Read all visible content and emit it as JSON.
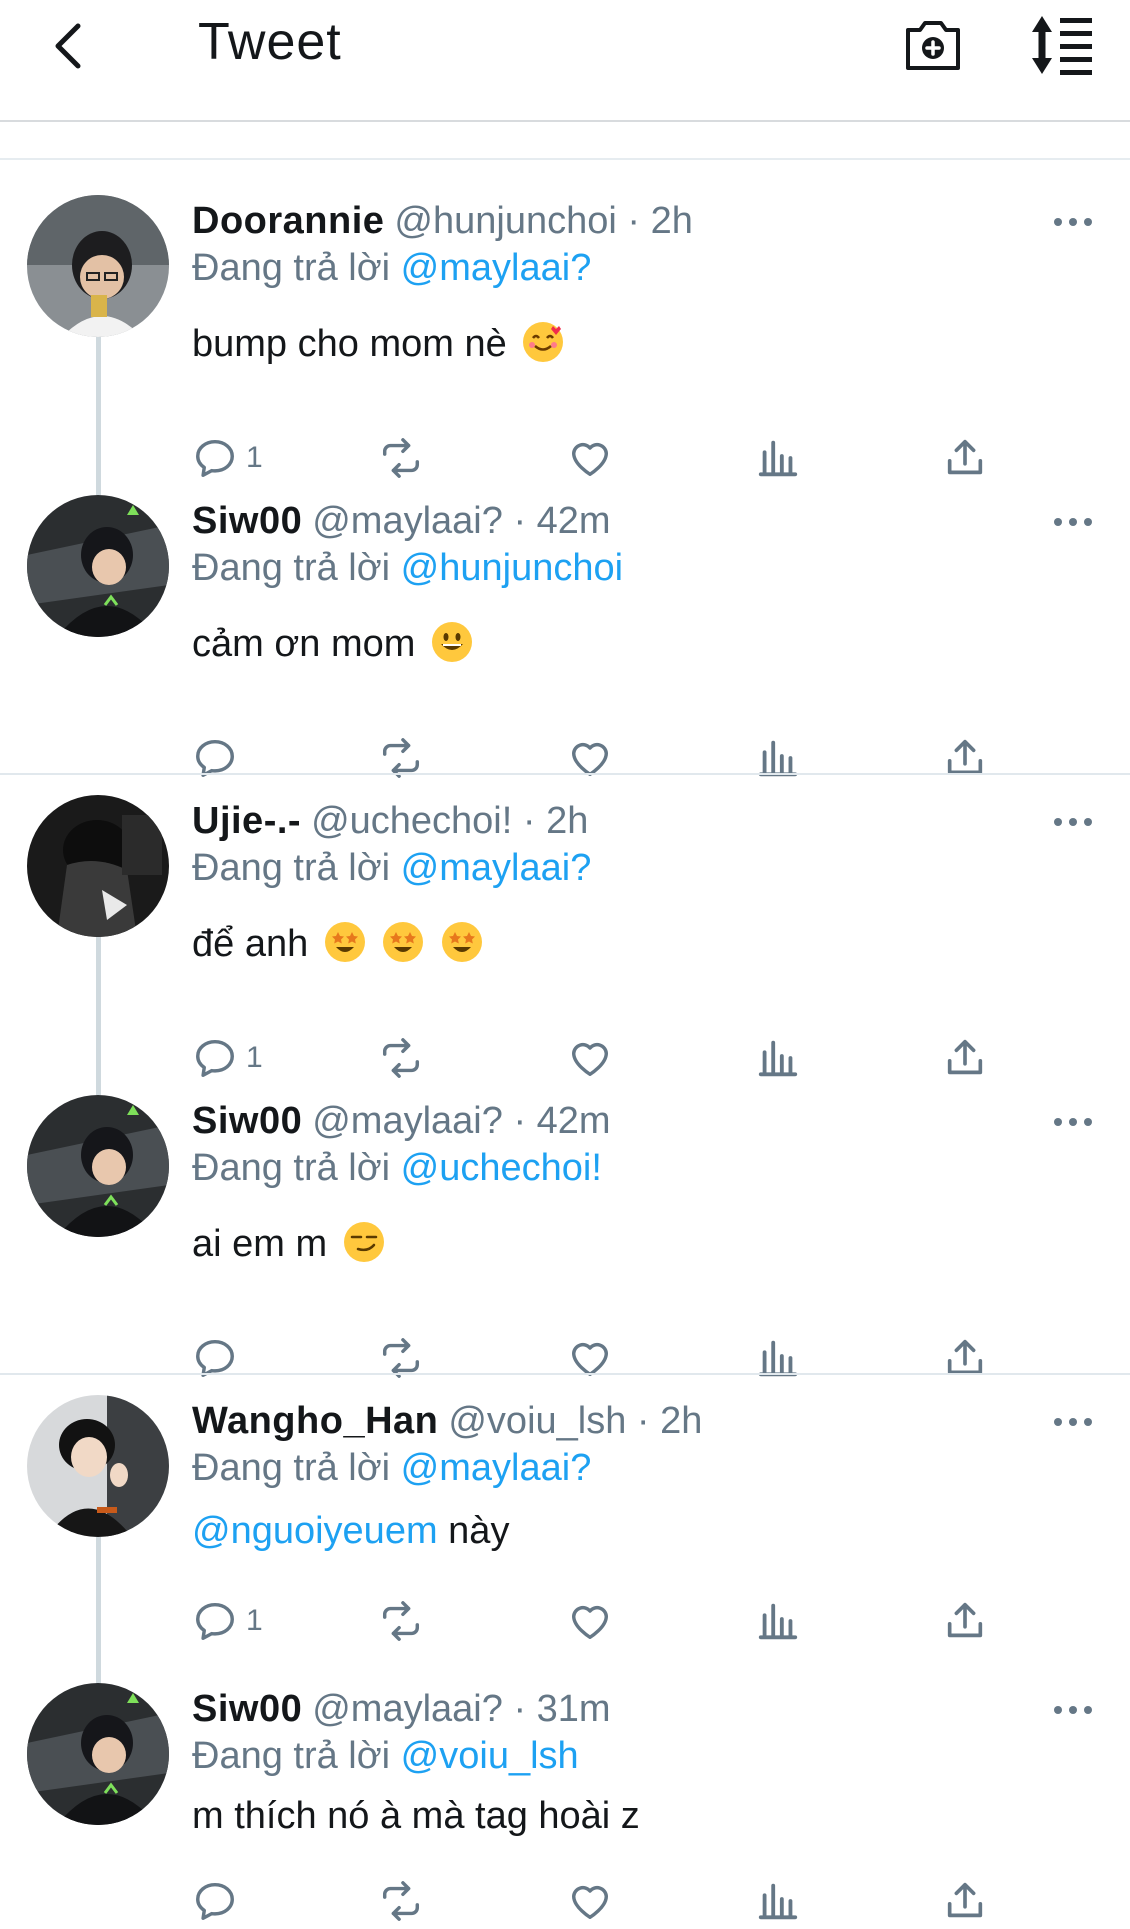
{
  "header": {
    "title": "Tweet",
    "icons": [
      "back-arrow-icon",
      "camera-plus-icon",
      "sort-icon"
    ]
  },
  "colors": {
    "accent": "#1da1f2",
    "muted": "#657786",
    "text": "#14171a"
  },
  "tweets": [
    {
      "name": "Doorannie",
      "handle": "@hunjunchoi · 2h",
      "reply_prefix": "Đang trả lời",
      "reply_to": "@maylaai?",
      "text": "bump cho mom nè",
      "emoji": "smiling-face-with-hearts",
      "reply_count": "1"
    },
    {
      "name": "Siw00",
      "handle": "@maylaai? · 42m",
      "reply_prefix": "Đang trả lời",
      "reply_to": "@hunjunchoi",
      "text": "cảm ơn mom",
      "emoji": "grinning-face",
      "reply_count": ""
    },
    {
      "name": "Ujie-.-",
      "handle": "@uchechoi! · 2h",
      "reply_prefix": "Đang trả lời",
      "reply_to": "@maylaai?",
      "text": "để anh",
      "emoji": "star-struck x3",
      "reply_count": "1"
    },
    {
      "name": "Siw00",
      "handle": "@maylaai? · 42m",
      "reply_prefix": "Đang trả lời",
      "reply_to": "@uchechoi!",
      "text": "ai em m",
      "emoji": "smirking-face",
      "reply_count": ""
    },
    {
      "name": "Wangho_Han",
      "handle": "@voiu_lsh · 2h",
      "reply_prefix": "Đang trả lời",
      "reply_to": "@maylaai?",
      "text_mention": "@nguoiyeuem",
      "text": "này",
      "reply_count": "1"
    },
    {
      "name": "Siw00",
      "handle": "@maylaai? · 31m",
      "reply_prefix": "Đang trả lời",
      "reply_to": "@voiu_lsh",
      "text": "m thích nó à mà tag hoài z",
      "reply_count": ""
    }
  ]
}
